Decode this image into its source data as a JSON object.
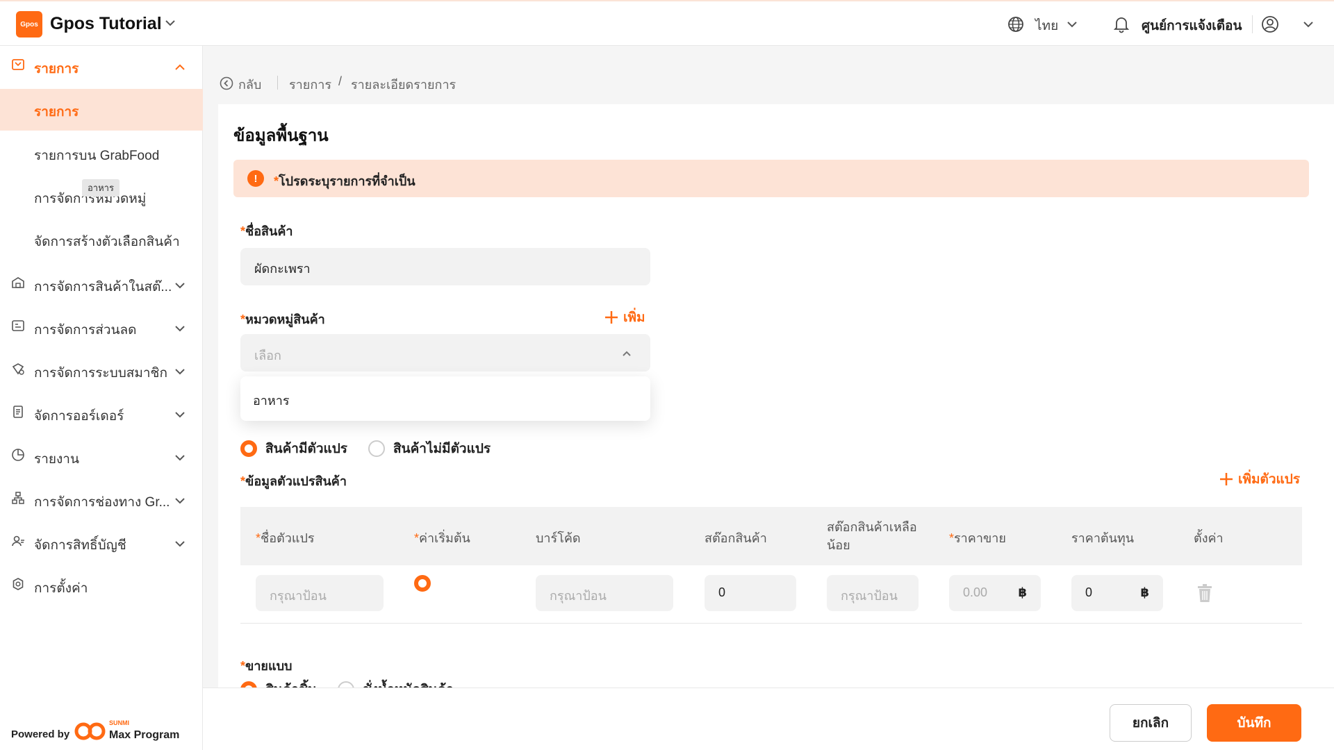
{
  "header": {
    "logo_text": "Gpos",
    "app_title": "Gpos Tutorial",
    "language": "ไทย",
    "notification_center": "ศูนย์การแจ้งเตือน"
  },
  "sidebar": {
    "groups": [
      {
        "label": "รายการ",
        "icon": "tag-icon",
        "expanded": true
      },
      {
        "label": "การจัดการสินค้าในสต๊...",
        "icon": "warehouse-icon"
      },
      {
        "label": "การจัดการส่วนลด",
        "icon": "discount-icon"
      },
      {
        "label": "การจัดการระบบสมาชิก",
        "icon": "member-icon"
      },
      {
        "label": "จัดการออร์เดอร์",
        "icon": "order-icon"
      },
      {
        "label": "รายงาน",
        "icon": "report-icon"
      },
      {
        "label": "การจัดการช่องทาง Gr...",
        "icon": "channel-icon"
      },
      {
        "label": "จัดการสิทธิ์บัญชี",
        "icon": "account-icon"
      },
      {
        "label": "การตั้งค่า",
        "icon": "settings-icon"
      }
    ],
    "sub_items": [
      {
        "label": "รายการ",
        "selected": true
      },
      {
        "label": "รายการบน GrabFood"
      },
      {
        "label": "การจัดการหมวดหมู่"
      },
      {
        "label": "จัดการสร้างตัวเลือกสินค้า"
      }
    ],
    "tooltip": "อาหาร",
    "powered_by": "Powered by",
    "brand_small": "SUNMI",
    "brand_name": "Max Program"
  },
  "breadcrumb": {
    "back": "กลับ",
    "item1": "รายการ",
    "separator": "/",
    "item2": "รายละเอียดรายการ"
  },
  "form": {
    "section_title": "ข้อมูลพื้นฐาน",
    "alert": "โปรดระบุรายการที่จำเป็น",
    "required_mark": "*",
    "product_name_label": "ชื่อสินค้า",
    "product_name_value": "ผัดกะเพรา",
    "category_label": "หมวดหมู่สินค้า",
    "add_label": "เพิ่ม",
    "category_placeholder": "เลือก",
    "dropdown_options": [
      "อาหาร"
    ],
    "variant_option_on": "สินค้ามีตัวแปร",
    "variant_option_off": "สินค้าไม่มีตัวแปร",
    "variant_info_label": "ข้อมูลตัวแปรสินค้า",
    "add_variant_label": "เพิ่มตัวแปร",
    "table_headers": {
      "name": "ชื่อตัวแปร",
      "default": "ค่าเริ่มต้น",
      "barcode": "บาร์โค้ด",
      "stock": "สต๊อกสินค้า",
      "low_stock": "สต๊อกสินค้าเหลือน้อย",
      "price": "ราคาขาย",
      "cost": "ราคาต้นทุน",
      "settings": "ตั้งค่า"
    },
    "row": {
      "name_placeholder": "กรุณาป้อน",
      "barcode_placeholder": "กรุณาป้อน",
      "stock_value": "0",
      "low_stock_placeholder": "กรุณาป้อน",
      "price_placeholder": "0.00",
      "cost_value": "0",
      "currency": "฿"
    },
    "sell_type_label": "ขายแบบ",
    "sell_option_on": "สินค้าชิ้น",
    "sell_option_off": "ชั่งน้ำหนักสินค้า"
  },
  "footer": {
    "cancel": "ยกเลิก",
    "save": "บันทึก"
  },
  "colors": {
    "accent": "#ff6a13",
    "accent_light": "#fde3d6"
  }
}
